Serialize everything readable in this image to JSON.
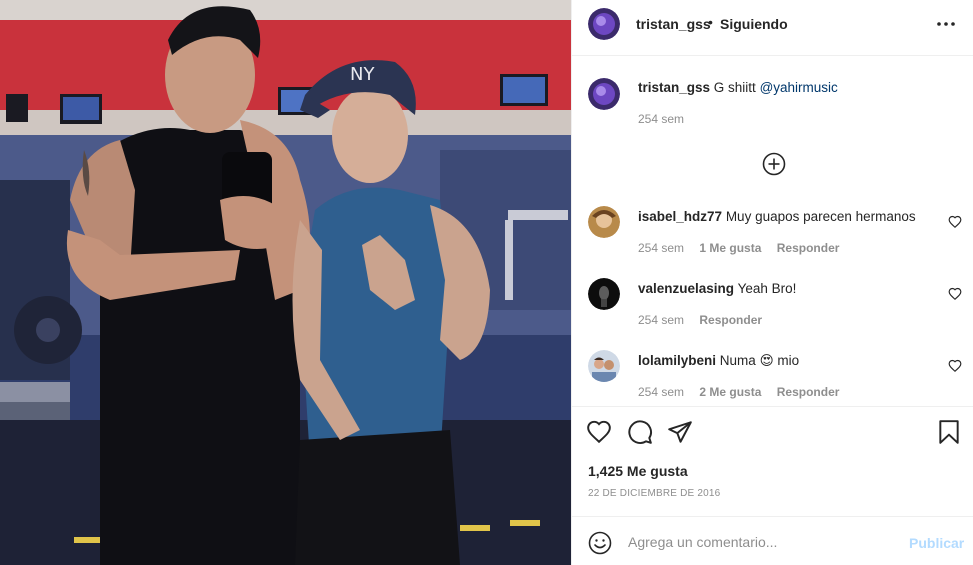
{
  "post": {
    "image_alt": "",
    "header": {
      "username": "tristan_gss",
      "separator": "•",
      "follow_status": "Siguiendo"
    },
    "caption": {
      "username": "tristan_gss",
      "text": "G shiitt",
      "mention": "@yahirmusic",
      "time": "254 sem"
    },
    "comments": [
      {
        "username": "isabel_hdz77",
        "text": "Muy guapos parecen hermanos",
        "time": "254 sem",
        "likes": "1 Me gusta",
        "reply": "Responder"
      },
      {
        "username": "valenzuelasing",
        "text": "Yeah Bro!",
        "time": "254 sem",
        "likes": "",
        "reply": "Responder"
      },
      {
        "username": "lolamilybeni",
        "text": "Numa",
        "emoji": "😍",
        "text_after": "mio",
        "time": "254 sem",
        "likes": "2 Me gusta",
        "reply": "Responder"
      }
    ],
    "likes_count": "1,425 Me gusta",
    "date": "22 DE DICIEMBRE DE 2016",
    "add_comment": {
      "placeholder": "Agrega un comentario...",
      "publish_label": "Publicar"
    },
    "icons": {
      "more": "more-options-icon",
      "load_more": "plus-circle-icon",
      "like": "heart-icon",
      "comment": "comment-icon",
      "share": "share-icon",
      "save": "bookmark-icon",
      "emoji": "emoji-icon"
    },
    "colors": {
      "text": "#262626",
      "secondary": "#8e8e8e",
      "mention": "#00376b",
      "publish_disabled": "#b3dbff",
      "border": "#efefef"
    }
  }
}
